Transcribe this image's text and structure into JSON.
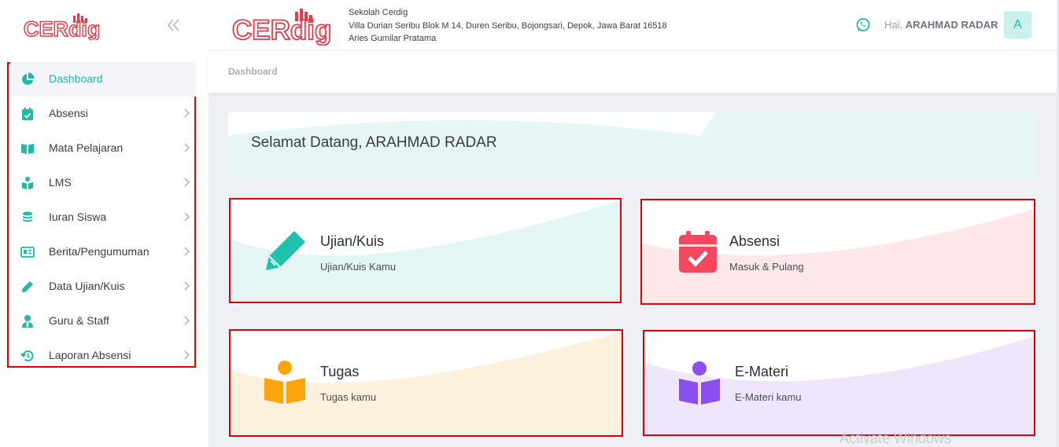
{
  "brand": {
    "logo_text": "CERdig"
  },
  "sidebar": {
    "items": [
      {
        "label": "Dashboard",
        "icon": "chart-pie-icon",
        "active": true
      },
      {
        "label": "Absensi",
        "icon": "calendar-check-icon"
      },
      {
        "label": "Mata Pelajaran",
        "icon": "book-open-icon"
      },
      {
        "label": "LMS",
        "icon": "reader-icon"
      },
      {
        "label": "Iuran Siswa",
        "icon": "coins-icon"
      },
      {
        "label": "Berita/Pengumuman",
        "icon": "newspaper-icon"
      },
      {
        "label": "Data Ujian/Kuis",
        "icon": "pencil-icon"
      },
      {
        "label": "Guru & Staff",
        "icon": "user-tie-icon"
      },
      {
        "label": "Laporan Absensi",
        "icon": "history-icon"
      }
    ]
  },
  "header": {
    "school_name": "Sekolah Cerdig",
    "school_address": "Villa Durian Seribu Blok M 14, Duren Seribu, Bojongsari, Depok, Jawa Barat 16518",
    "school_person": "Aries Gumilar Pratama",
    "greeting": "Hai,",
    "user_name": "ARAHMAD RADAR",
    "avatar_initial": "A"
  },
  "breadcrumb": "Dashboard",
  "welcome": "Selamat Datang, ARAHMAD RADAR",
  "cards": [
    {
      "title": "Ujian/Kuis",
      "subtitle": "Ujian/Kuis Kamu",
      "icon": "pencil-icon",
      "color": "#1fc1ae",
      "bg": "#e3f6f3"
    },
    {
      "title": "Absensi",
      "subtitle": "Masuk & Pulang",
      "icon": "calendar-check-icon",
      "color": "#f4485e",
      "bg": "#fde7e8"
    },
    {
      "title": "Tugas",
      "subtitle": "Tugas kamu",
      "icon": "reader-icon",
      "color": "#fda40a",
      "bg": "#fdf1de"
    },
    {
      "title": "E-Materi",
      "subtitle": "E-Materi kamu",
      "icon": "reader-icon",
      "color": "#8b4ff0",
      "bg": "#efe6fb"
    }
  ],
  "watermark": "Activate Windows",
  "colors": {
    "accent": "#1fb9a6",
    "brand_red": "#e8394a",
    "highlight_border": "#e00000"
  }
}
